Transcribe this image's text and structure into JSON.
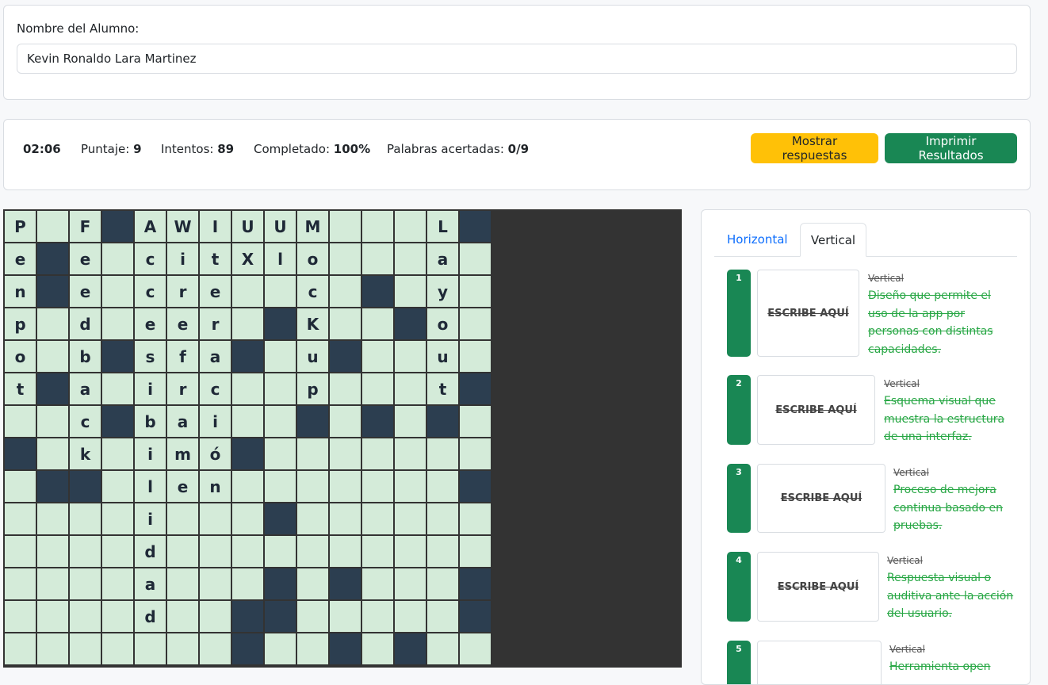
{
  "student": {
    "label": "Nombre del Alumno:",
    "name": "Kevin Ronaldo Lara Martinez"
  },
  "stats": {
    "time": "02:06",
    "score_label": "Puntaje: ",
    "score": "9",
    "attempts_label": "Intentos: ",
    "attempts": "89",
    "completed_label": "Completado: ",
    "completed": "100%",
    "words_label": "Palabras acertadas: ",
    "words": "0/9"
  },
  "buttons": {
    "show_answers": "Mostrar respuestas",
    "print": "Imprimir Resultados"
  },
  "grid": {
    "rows": [
      "P F#AWIUUM   L#",
      "e#e ciitXlo   a ",
      "n#e crte  c # y ",
      "p d eer #K #o  ",
      "o b#sfa# u#  u ",
      "t#a irc  p   t#",
      "  c#bai  # # # ",
      "# k im6#       ",
      " ##  len      #",
      "    i   #      ",
      "    d          ",
      "    a   # #   #",
      "    d  ##     #",
      "       #  # #  "
    ],
    "cells": [
      [
        "P",
        "",
        "F",
        "#",
        "A",
        "W",
        "I",
        "U",
        "U",
        "M",
        "",
        "",
        "",
        "L",
        "#"
      ],
      [
        "e",
        "#",
        "e",
        "",
        "c",
        "i",
        "t",
        "X",
        "l",
        "o",
        "",
        "",
        "",
        "a",
        ""
      ],
      [
        "n",
        "#",
        "e",
        "",
        "c",
        "r",
        "e",
        "",
        "",
        "c",
        "",
        "#",
        "",
        "y",
        ""
      ],
      [
        "p",
        "",
        "d",
        "",
        "e",
        "e",
        "r",
        "",
        "#",
        "K",
        "",
        "",
        "#",
        "o",
        ""
      ],
      [
        "o",
        "",
        "b",
        "#",
        "s",
        "f",
        "a",
        "#",
        "",
        "u",
        "#",
        "",
        "",
        "u",
        ""
      ],
      [
        "t",
        "#",
        "a",
        "",
        "i",
        "r",
        "c",
        "",
        "",
        "p",
        "",
        "",
        "",
        "t",
        "#"
      ],
      [
        "",
        "",
        "c",
        "#",
        "b",
        "a",
        "i",
        "",
        "",
        "#",
        "",
        "#",
        "",
        "#",
        ""
      ],
      [
        "#",
        "",
        "k",
        "",
        "i",
        "m",
        "ó",
        "#",
        "",
        "",
        "",
        "",
        "",
        "",
        ""
      ],
      [
        "",
        "#",
        "#",
        "",
        "l",
        "e",
        "n",
        "",
        "",
        "",
        "",
        "",
        "",
        "",
        "#"
      ],
      [
        "",
        "",
        "",
        "",
        "i",
        "",
        "",
        "",
        "#",
        "",
        "",
        "",
        "",
        "",
        ""
      ],
      [
        "",
        "",
        "",
        "",
        "d",
        "",
        "",
        "",
        "",
        "",
        "",
        "",
        "",
        "",
        ""
      ],
      [
        "",
        "",
        "",
        "",
        "a",
        "",
        "",
        "",
        "#",
        "",
        "#",
        "",
        "",
        "",
        "#"
      ],
      [
        "",
        "",
        "",
        "",
        "d",
        "",
        "",
        "#",
        "#",
        "",
        "",
        "",
        "",
        "",
        "#"
      ],
      [
        "",
        "",
        "",
        "",
        "",
        "",
        "",
        "#",
        "",
        "",
        "#",
        "",
        "#",
        "",
        ""
      ]
    ]
  },
  "clues": {
    "tabs": [
      "Horizontal",
      "Vertical"
    ],
    "placeholder": "ESCRIBE AQUÍ",
    "items": [
      {
        "num": "1",
        "dir": "Vertical",
        "text": "Diseño que permite el uso de la app por personas con distintas capacidades."
      },
      {
        "num": "2",
        "dir": "Vertical",
        "text": "Esquema visual que muestra la estructura de una interfaz."
      },
      {
        "num": "3",
        "dir": "Vertical",
        "text": "Proceso de mejora continua basado en pruebas."
      },
      {
        "num": "4",
        "dir": "Vertical",
        "text": "Respuesta visual o auditiva ante la acción del usuario."
      },
      {
        "num": "5",
        "dir": "Vertical",
        "text": "Herramienta open"
      }
    ]
  },
  "colors": {
    "cell": "#d4ebd9",
    "block": "#2c3e50",
    "accent": "#198754",
    "warning": "#ffc107"
  }
}
